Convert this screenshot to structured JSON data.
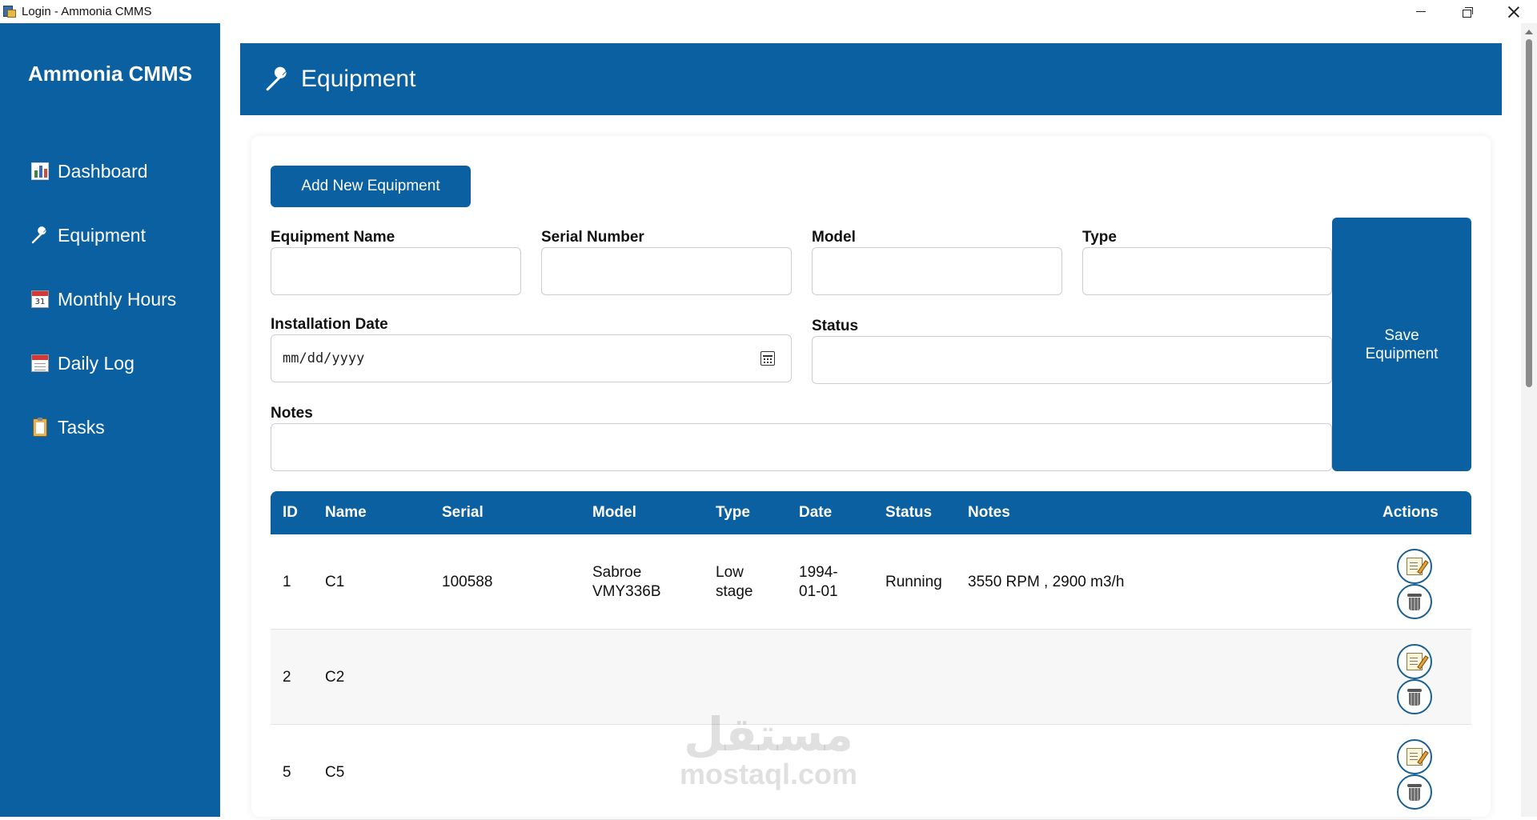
{
  "window": {
    "title": "Login - Ammonia CMMS"
  },
  "sidebar": {
    "brand": "Ammonia CMMS",
    "items": [
      {
        "label": "Dashboard",
        "icon": "bar-chart-icon"
      },
      {
        "label": "Equipment",
        "icon": "wrench-icon"
      },
      {
        "label": "Monthly Hours",
        "icon": "calendar-icon"
      },
      {
        "label": "Daily Log",
        "icon": "tear-off-calendar-icon"
      },
      {
        "label": "Tasks",
        "icon": "clipboard-icon"
      }
    ]
  },
  "header": {
    "title": "Equipment",
    "icon": "wrench-icon"
  },
  "form": {
    "add_button": "Add New Equipment",
    "save_button_line1": "Save",
    "save_button_line2": "Equipment",
    "fields": {
      "equipment_name": {
        "label": "Equipment Name",
        "value": ""
      },
      "serial_number": {
        "label": "Serial Number",
        "value": ""
      },
      "model": {
        "label": "Model",
        "value": ""
      },
      "type": {
        "label": "Type",
        "value": ""
      },
      "installation_date": {
        "label": "Installation Date",
        "placeholder": "mm/dd/yyyy"
      },
      "status": {
        "label": "Status",
        "value": ""
      },
      "notes": {
        "label": "Notes",
        "value": ""
      }
    }
  },
  "table": {
    "columns": [
      "ID",
      "Name",
      "Serial",
      "Model",
      "Type",
      "Date",
      "Status",
      "Notes",
      "Actions"
    ],
    "rows": [
      {
        "id": "1",
        "name": "C1",
        "serial": "100588",
        "model_line1": "Sabroe",
        "model_line2": "VMY336B",
        "type_line1": "Low",
        "type_line2": "stage",
        "date_line1": "1994-",
        "date_line2": "01-01",
        "status": "Running",
        "notes": "3550 RPM , 2900 m3/h"
      },
      {
        "id": "2",
        "name": "C2",
        "serial": "",
        "model_line1": "",
        "model_line2": "",
        "type_line1": "",
        "type_line2": "",
        "date_line1": "",
        "date_line2": "",
        "status": "",
        "notes": ""
      },
      {
        "id": "5",
        "name": "C5",
        "serial": "",
        "model_line1": "",
        "model_line2": "",
        "type_line1": "",
        "type_line2": "",
        "date_line1": "",
        "date_line2": "",
        "status": "",
        "notes": ""
      }
    ]
  },
  "watermark": {
    "arabic": "مستقل",
    "latin": "mostaql.com"
  },
  "colors": {
    "primary": "#0a60a0",
    "background": "#ffffff",
    "row_alt": "#f7f7f7"
  }
}
